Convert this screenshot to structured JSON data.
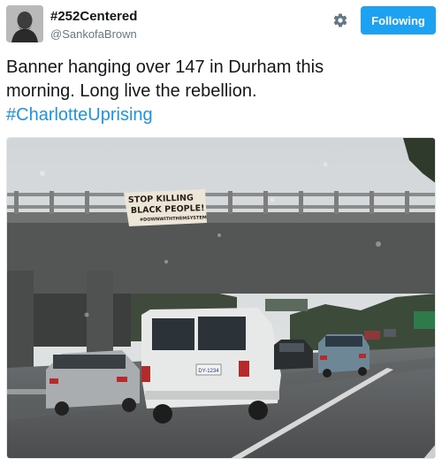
{
  "user": {
    "display_name": "#252Centered",
    "handle": "@SankofaBrown",
    "avatar_icon": "person-avatar"
  },
  "actions": {
    "settings_icon": "gear-icon",
    "follow_label": "Following",
    "follow_color": "#1da1f2"
  },
  "tweet": {
    "text_line1": "Banner hanging over 147 in Durham this",
    "text_line2": "morning. Long live the rebellion.",
    "hashtag": "#CharlotteUprising",
    "hashtag_color": "#1b95e0"
  },
  "photo": {
    "banner_line1": "STOP KILLING",
    "banner_line2": "BLACK PEOPLE!",
    "banner_line3": "#DOWNWITHTHEMSYSTEM",
    "plate_number": "DY-1234"
  }
}
